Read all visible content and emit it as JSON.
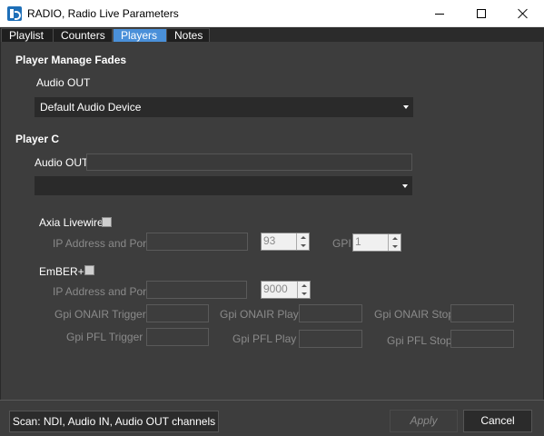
{
  "window": {
    "title": "RADIO, Radio Live Parameters"
  },
  "tabs": [
    {
      "label": "Playlist"
    },
    {
      "label": "Counters"
    },
    {
      "label": "Players"
    },
    {
      "label": "Notes"
    }
  ],
  "manage_fades": {
    "title": "Player Manage Fades",
    "audio_out_label": "Audio OUT",
    "audio_device": "Default Audio Device"
  },
  "player_c": {
    "title": "Player C",
    "audio_out_label": "Audio OUT",
    "audio_out_value": "",
    "dropdown_value": "",
    "axia": {
      "label": "Axia Livewire",
      "ip_label": "IP Address and Port",
      "ip_value": "",
      "port_value": "93",
      "gpi_label": "GPI",
      "gpi_value": "1"
    },
    "ember": {
      "label": "EmBER+",
      "ip_label": "IP Address and Port",
      "ip_value": "",
      "port_value": "9000",
      "gpi_onair_trigger_label": "Gpi ONAIR Trigger",
      "gpi_onair_play_label": "Gpi ONAIR Play",
      "gpi_onair_stop_label": "Gpi ONAIR Stop",
      "gpi_pfl_trigger_label": "Gpi PFL Trigger",
      "gpi_pfl_play_label": "Gpi PFL Play",
      "gpi_pfl_stop_label": "Gpi PFL Stop"
    }
  },
  "footer": {
    "scan_label": "Scan: NDI, Audio IN, Audio OUT channels",
    "apply_label": "Apply",
    "cancel_label": "Cancel"
  },
  "icons": {
    "app": "radio-app-icon",
    "minimize": "minimize-icon",
    "maximize": "maximize-icon",
    "close": "close-icon"
  },
  "colors": {
    "panel_bg": "#3d3d3d",
    "active_tab": "#4a90d9",
    "text": "#ffffff",
    "disabled_text": "#8a8a8a"
  }
}
